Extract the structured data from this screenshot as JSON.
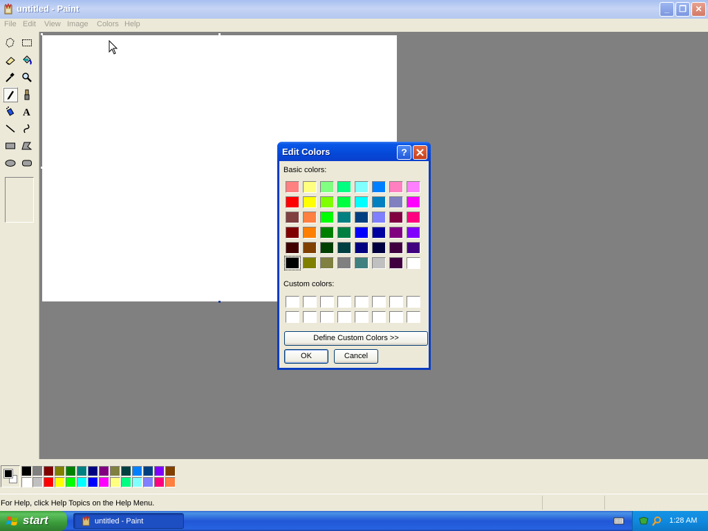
{
  "window": {
    "title": "untitled - Paint",
    "controls": {
      "minimize": "_",
      "maximize": "❐",
      "close": "✕"
    }
  },
  "menu": [
    "File",
    "Edit",
    "View",
    "Image",
    "Colors",
    "Help"
  ],
  "toolbox": {
    "tools": [
      "free-form-select",
      "select",
      "eraser",
      "fill-with-color",
      "pick-color",
      "magnifier",
      "pencil",
      "brush",
      "airbrush",
      "text",
      "line",
      "curve",
      "rectangle",
      "polygon",
      "ellipse",
      "rounded-rectangle"
    ],
    "active": "pencil",
    "text_tool_glyph": "A"
  },
  "palette": {
    "foreground": "#000000",
    "background": "#ffffff",
    "row1": [
      "#000000",
      "#808080",
      "#800000",
      "#808000",
      "#008000",
      "#008080",
      "#000080",
      "#800080",
      "#808040",
      "#004040",
      "#0080ff",
      "#004080",
      "#8000ff",
      "#804000"
    ],
    "row2": [
      "#ffffff",
      "#c0c0c0",
      "#ff0000",
      "#ffff00",
      "#00ff00",
      "#00ffff",
      "#0000ff",
      "#ff00ff",
      "#ffff80",
      "#00ff80",
      "#80ffff",
      "#8080ff",
      "#ff0080",
      "#ff8040"
    ]
  },
  "status": {
    "help_text": "For Help, click Help Topics on the Help Menu."
  },
  "taskbar": {
    "start_label": "start",
    "task_label": "untitled - Paint",
    "clock": "1:28 AM"
  },
  "dialog": {
    "title": "Edit Colors",
    "help_glyph": "?",
    "basic_colors_label": "Basic colors:",
    "custom_colors_label": "Custom colors:",
    "define_button": "Define Custom Colors >>",
    "ok_button": "OK",
    "cancel_button": "Cancel",
    "selected_index": 40,
    "basic_colors": [
      "#ff8080",
      "#ffff80",
      "#80ff80",
      "#00ff80",
      "#80ffff",
      "#0080ff",
      "#ff80c0",
      "#ff80ff",
      "#ff0000",
      "#ffff00",
      "#80ff00",
      "#00ff40",
      "#00ffff",
      "#0080c0",
      "#8080c0",
      "#ff00ff",
      "#804040",
      "#ff8040",
      "#00ff00",
      "#008080",
      "#004080",
      "#8080ff",
      "#800040",
      "#ff0080",
      "#800000",
      "#ff8000",
      "#008000",
      "#008040",
      "#0000ff",
      "#0000a0",
      "#800080",
      "#8000ff",
      "#400000",
      "#804000",
      "#004000",
      "#004040",
      "#000080",
      "#000040",
      "#400040",
      "#400080",
      "#000000",
      "#808000",
      "#808040",
      "#808080",
      "#408080",
      "#c0c0c0",
      "#400040",
      "#ffffff"
    ],
    "custom_colors": [
      "#ffffff",
      "#ffffff",
      "#ffffff",
      "#ffffff",
      "#ffffff",
      "#ffffff",
      "#ffffff",
      "#ffffff",
      "#ffffff",
      "#ffffff",
      "#ffffff",
      "#ffffff",
      "#ffffff",
      "#ffffff",
      "#ffffff",
      "#ffffff"
    ]
  }
}
